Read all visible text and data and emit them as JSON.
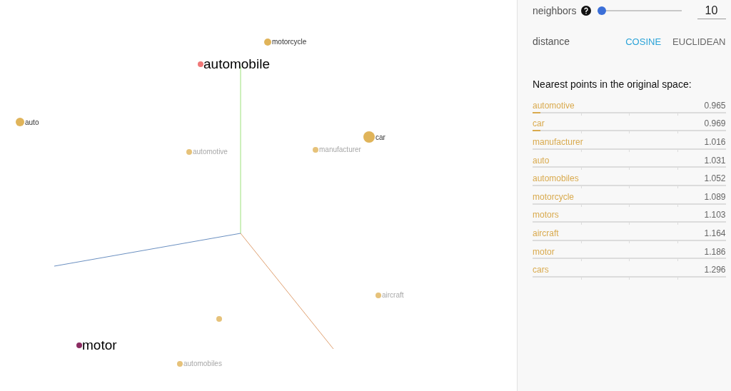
{
  "canvas": {
    "points": [
      {
        "label": "motorcycle",
        "kind": "near",
        "color": "#e0b45a"
      },
      {
        "label": "automobile",
        "kind": "selected",
        "color": "#f07878"
      },
      {
        "label": "auto",
        "kind": "near",
        "color": "#e0b45a"
      },
      {
        "label": "automotive",
        "kind": "faded",
        "color": "#e6c27a"
      },
      {
        "label": "manufacturer",
        "kind": "faded",
        "color": "#e6c27a"
      },
      {
        "label": "car",
        "kind": "near",
        "color": "#e0b45a"
      },
      {
        "label": "aircraft",
        "kind": "faded",
        "color": "#e6c27a"
      },
      {
        "kind": "faded",
        "color": "#e6c27a"
      },
      {
        "label": "motor",
        "kind": "selected",
        "color": "#8b2d62"
      },
      {
        "label": "automobiles",
        "kind": "faded",
        "color": "#e6c27a"
      }
    ]
  },
  "panel": {
    "neighbors": {
      "label": "neighbors",
      "level": 0,
      "value": "10"
    },
    "distance": {
      "label": "distance",
      "options": [
        {
          "label": "COSINE",
          "selected": true
        },
        {
          "label": "EUCLIDEAN",
          "selected": false
        }
      ]
    },
    "heading": "Nearest points in the original space:",
    "neighbors_list": [
      {
        "word": "automotive",
        "distance": "0.965",
        "level": 0.04
      },
      {
        "word": "car",
        "distance": "0.969",
        "level": 0.04
      },
      {
        "word": "manufacturer",
        "distance": "1.016"
      },
      {
        "word": "auto",
        "distance": "1.031"
      },
      {
        "word": "automobiles",
        "distance": "1.052"
      },
      {
        "word": "motorcycle",
        "distance": "1.089"
      },
      {
        "word": "motors",
        "distance": "1.103"
      },
      {
        "word": "aircraft",
        "distance": "1.164"
      },
      {
        "word": "motor",
        "distance": "1.186"
      },
      {
        "word": "cars",
        "distance": "1.296"
      }
    ]
  }
}
